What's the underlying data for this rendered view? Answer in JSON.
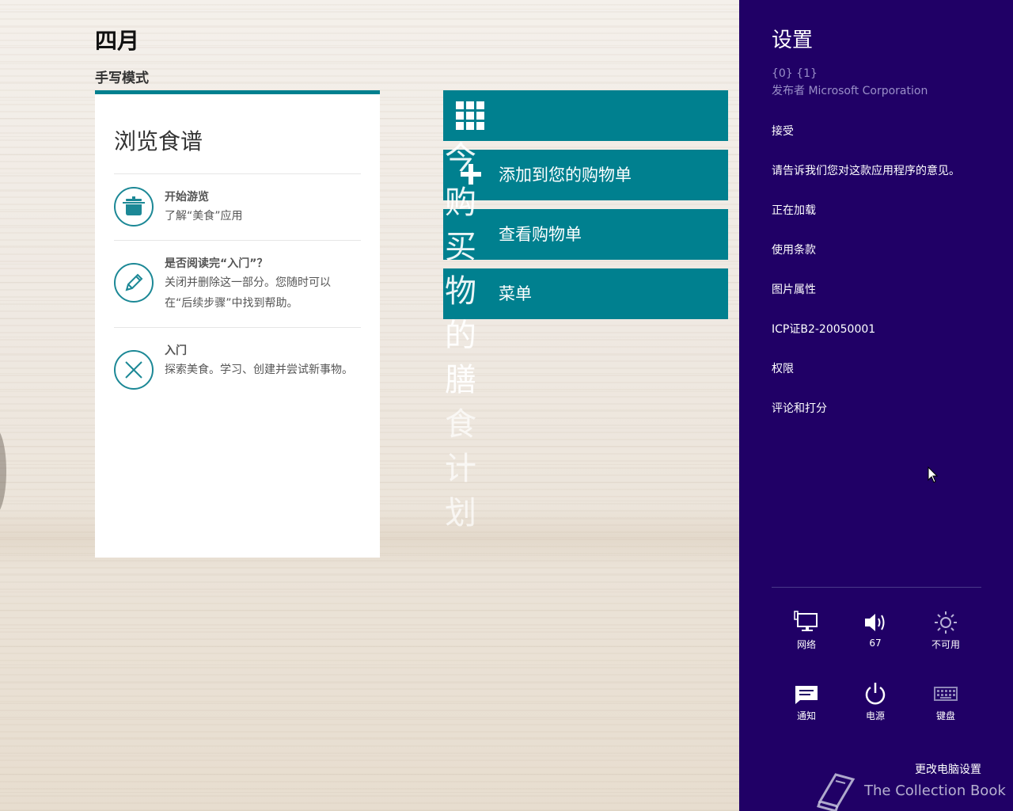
{
  "app": {
    "title": "四月",
    "mode": "手写模式"
  },
  "card": {
    "title": "浏览食谱",
    "items": [
      {
        "head": "开始游览",
        "body": "了解“美食”应用",
        "icon": "cooking-pot-icon"
      },
      {
        "head": "是否阅读完“入门”？",
        "body": "关闭并删除这一部分。您随时可以在“后续步骤”中找到帮助。",
        "icon": "pencil-icon"
      },
      {
        "head": "入门",
        "body": "探索美食。学习、创建并尝试新事物。",
        "icon": "close-icon"
      }
    ]
  },
  "tiles": {
    "grid_icon": "grid-icon",
    "add_to_list": "添加到您的购物单",
    "view_list": "查看购物单",
    "menu": "菜单"
  },
  "vertical_text": [
    "今",
    "购",
    "买",
    "物",
    "的",
    "膳",
    "食",
    "计",
    "划"
  ],
  "settings": {
    "title": "设置",
    "app_version": "{0} {1}",
    "publisher": "发布者 Microsoft Corporation",
    "links": [
      "接受",
      "请告诉我们您对这款应用程序的意见。",
      "正在加载",
      "使用条款",
      "图片属性",
      "ICP证B2-20050001",
      "权限",
      "评论和打分"
    ],
    "quick": {
      "network": "网络",
      "volume": "67",
      "brightness": "不可用",
      "notifications": "通知",
      "power": "电源",
      "keyboard": "键盘"
    },
    "change_pc_settings": "更改电脑设置"
  },
  "watermark": "The Collection Book",
  "colors": {
    "teal": "#00808f",
    "settings_bg": "#200066"
  }
}
